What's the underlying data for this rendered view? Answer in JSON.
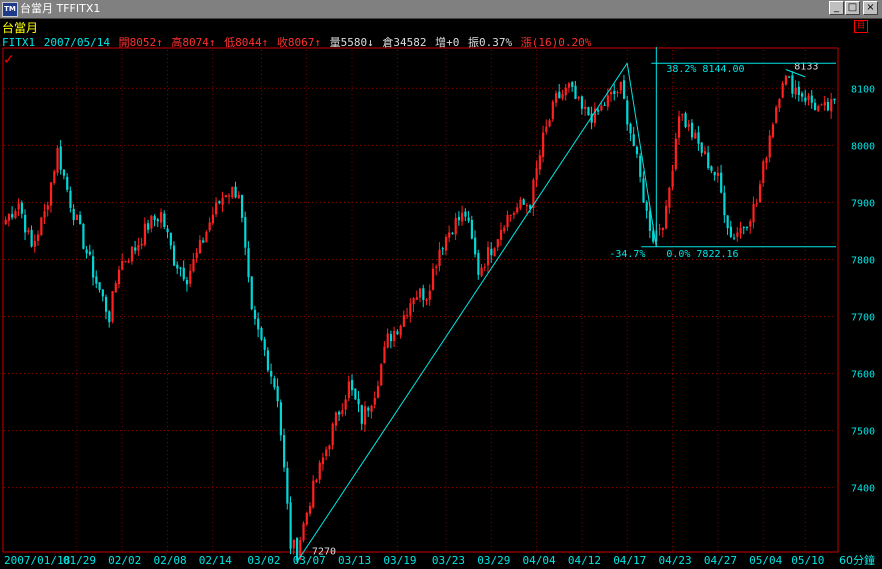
{
  "window": {
    "title": "台當月 TFFITX1",
    "buttons": [
      "_",
      "□",
      "×"
    ]
  },
  "header": {
    "name": "台當月",
    "symbol": "FITX1",
    "date": "2007/05/14",
    "open_label": "開8052↑",
    "high_label": "高8074↑",
    "low_label": "低8044↑",
    "close_label": "收8067↑",
    "volume_label": "量5580↓",
    "oi_label": "倉34582",
    "inc_label": "增+0",
    "amp_label": "振0.37%",
    "change_label": "漲(16)0.20%"
  },
  "chart_data": {
    "type": "candlestick",
    "interval_label": "60分鐘",
    "ylim": [
      7280,
      8180
    ],
    "y_ticks": [
      7400,
      7500,
      7600,
      7700,
      7800,
      7900,
      8000,
      8100
    ],
    "x_labels": [
      "2007/01/18",
      "01/29",
      "02/02",
      "02/08",
      "02/14",
      "03/02",
      "03/07",
      "03/13",
      "03/19",
      "03/23",
      "03/29",
      "04/04",
      "04/12",
      "04/17",
      "04/23",
      "04/27",
      "05/04",
      "05/10"
    ],
    "x_label_bars": [
      0,
      22,
      36,
      50,
      64,
      79,
      93,
      107,
      121,
      136,
      150,
      164,
      178,
      192,
      206,
      220,
      234,
      247
    ],
    "bar_count": 257,
    "anchors": [
      [
        0,
        7870
      ],
      [
        4,
        7900
      ],
      [
        8,
        7820
      ],
      [
        12,
        7880
      ],
      [
        16,
        7990
      ],
      [
        20,
        7900
      ],
      [
        24,
        7830
      ],
      [
        28,
        7760
      ],
      [
        32,
        7700
      ],
      [
        35,
        7790
      ],
      [
        40,
        7820
      ],
      [
        44,
        7860
      ],
      [
        48,
        7880
      ],
      [
        52,
        7800
      ],
      [
        56,
        7770
      ],
      [
        60,
        7820
      ],
      [
        64,
        7880
      ],
      [
        68,
        7920
      ],
      [
        72,
        7920
      ],
      [
        76,
        7700
      ],
      [
        80,
        7640
      ],
      [
        84,
        7560
      ],
      [
        88,
        7300
      ],
      [
        90,
        7290
      ],
      [
        94,
        7380
      ],
      [
        98,
        7450
      ],
      [
        102,
        7520
      ],
      [
        106,
        7580
      ],
      [
        110,
        7520
      ],
      [
        114,
        7570
      ],
      [
        118,
        7660
      ],
      [
        122,
        7690
      ],
      [
        126,
        7740
      ],
      [
        130,
        7740
      ],
      [
        134,
        7820
      ],
      [
        138,
        7860
      ],
      [
        142,
        7880
      ],
      [
        146,
        7780
      ],
      [
        150,
        7820
      ],
      [
        154,
        7870
      ],
      [
        158,
        7890
      ],
      [
        162,
        7900
      ],
      [
        166,
        8010
      ],
      [
        170,
        8080
      ],
      [
        174,
        8100
      ],
      [
        178,
        8060
      ],
      [
        182,
        8050
      ],
      [
        186,
        8080
      ],
      [
        190,
        8100
      ],
      [
        194,
        8000
      ],
      [
        198,
        7880
      ],
      [
        200,
        7840
      ],
      [
        204,
        7880
      ],
      [
        208,
        8060
      ],
      [
        212,
        8020
      ],
      [
        216,
        7980
      ],
      [
        220,
        7940
      ],
      [
        224,
        7840
      ],
      [
        228,
        7860
      ],
      [
        232,
        7900
      ],
      [
        236,
        8020
      ],
      [
        240,
        8120
      ],
      [
        244,
        8100
      ],
      [
        248,
        8080
      ],
      [
        252,
        8060
      ],
      [
        256,
        8070
      ]
    ],
    "trendlines": [
      {
        "from": [
          90,
          7270
        ],
        "to": [
          192,
          8144
        ]
      },
      {
        "from": [
          192,
          8144
        ],
        "to": [
          201,
          7822
        ]
      },
      {
        "from": [
          241,
          8133
        ],
        "to": [
          247,
          8120
        ]
      }
    ],
    "fib": {
      "level_high": 8144,
      "level_low": 7822.16,
      "high_label": "38.2% 8144.00",
      "low_label": "0.0% 7822.16",
      "neg_label": "-34.7%",
      "vertical_at_bar": 201,
      "range_bars": [
        201,
        258
      ]
    },
    "annotations": [
      {
        "text": "7270",
        "bar": 94,
        "value": 7290
      },
      {
        "text": "8133",
        "bar": 243,
        "value": 8140
      }
    ],
    "colors": {
      "up": "#ff2020",
      "down": "#00d8d8",
      "grid": "#8a0000",
      "axis_text": "#00e5e5",
      "trendline": "#00e5e5",
      "fib": "#00e5e5",
      "border": "#cc0000"
    }
  }
}
